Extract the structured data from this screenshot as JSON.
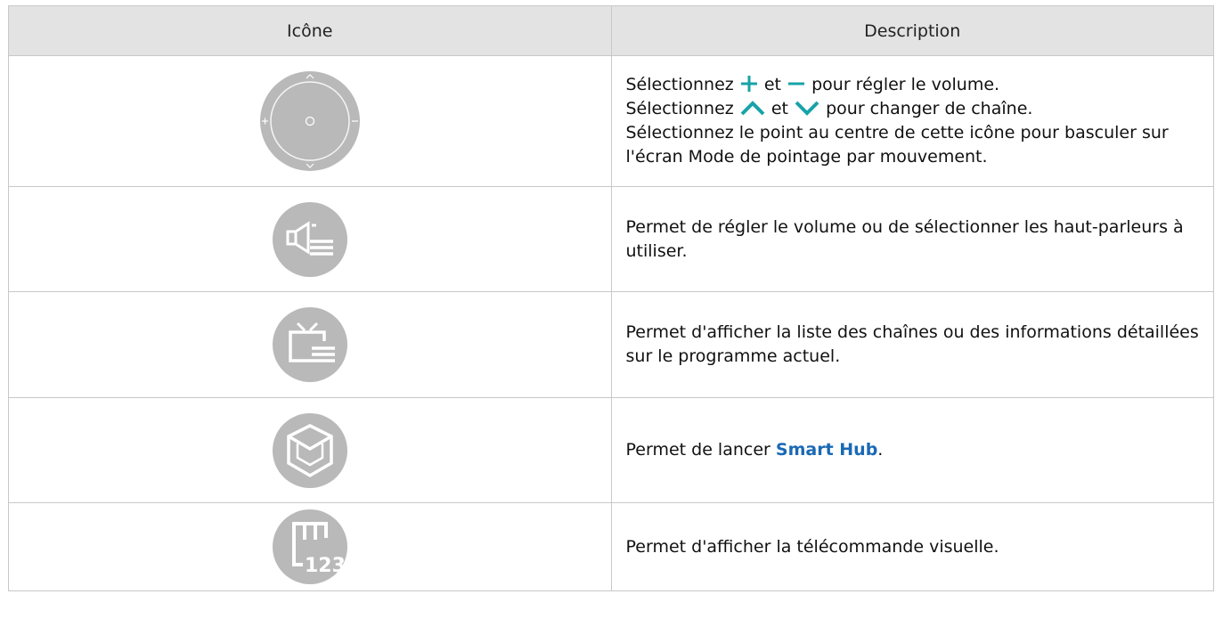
{
  "header": {
    "col_icon": "Icône",
    "col_desc": "Description"
  },
  "rows": [
    {
      "icon": "volume-channel-dpad-icon",
      "lines": [
        {
          "pre": "Sélectionnez",
          "g1": "plus-icon",
          "mid": "et",
          "g2": "minus-icon",
          "post": "pour régler le volume."
        },
        {
          "pre": "Sélectionnez",
          "g1": "chevron-up-icon",
          "mid": "et",
          "g2": "chevron-down-icon",
          "post": "pour changer de chaîne."
        }
      ],
      "text": "Sélectionnez le point au centre de cette icône pour basculer sur l'écran Mode de pointage par mouvement."
    },
    {
      "icon": "speaker-list-icon",
      "text": "Permet de régler le volume ou de sélectionner les haut-parleurs à utiliser."
    },
    {
      "icon": "tv-list-icon",
      "text": "Permet d'afficher la liste des chaînes ou des informations détaillées sur le programme actuel."
    },
    {
      "icon": "smart-hub-cube-icon",
      "pre": "Permet de lancer",
      "link": "Smart Hub",
      "post": "."
    },
    {
      "icon": "virtual-remote-123-icon",
      "text": "Permet d'afficher la télécommande visuelle.",
      "glyph_text": "123"
    }
  ],
  "colors": {
    "header_bg": "#e3e3e3",
    "icon_bg": "#b9b9b9",
    "accent_teal": "#17a3a8",
    "link_blue": "#1a69b4",
    "border": "#c8c8c8"
  }
}
